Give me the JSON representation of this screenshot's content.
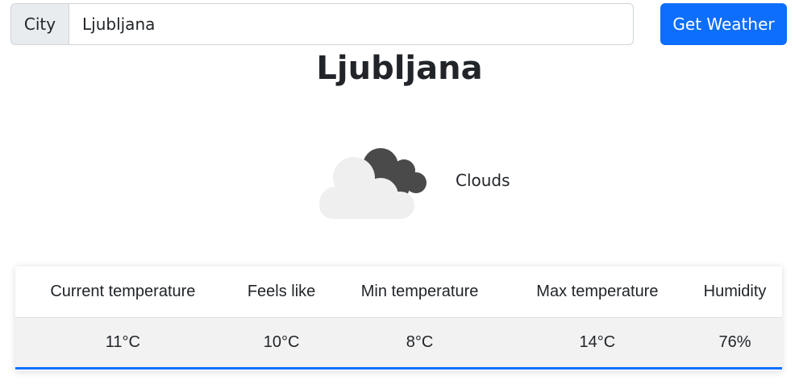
{
  "search": {
    "addon_label": "City",
    "value": "Ljubljana",
    "button_label": "Get Weather"
  },
  "city_name": "Ljubljana",
  "weather": {
    "icon": "clouds-icon",
    "condition": "Clouds"
  },
  "table": {
    "headers": [
      "Current temperature",
      "Feels like",
      "Min temperature",
      "Max temperature",
      "Humidity"
    ],
    "values": [
      "11°C",
      "10°C",
      "8°C",
      "14°C",
      "76%"
    ]
  },
  "colors": {
    "accent": "#0d6efd",
    "cloud_light": "#efefef",
    "cloud_dark": "#4a4a4a"
  }
}
